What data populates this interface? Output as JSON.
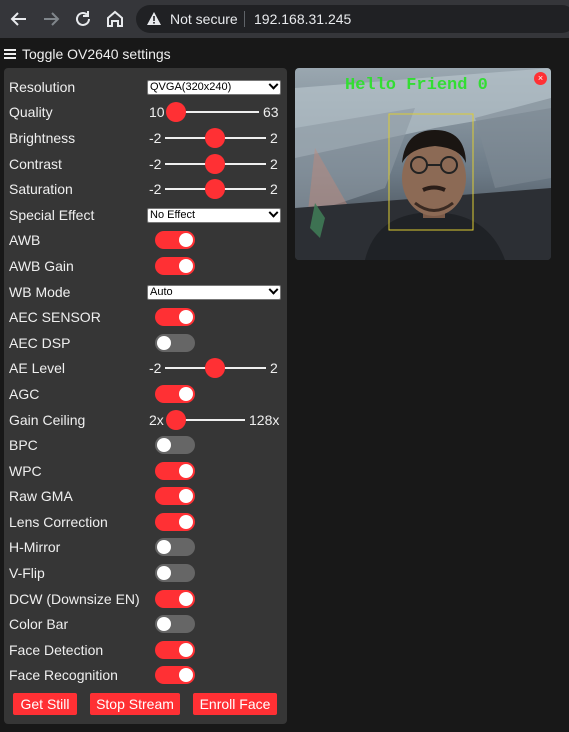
{
  "browser": {
    "security_label": "Not secure",
    "url": "192.168.31.245"
  },
  "page": {
    "toggle_label": "Toggle OV2640 settings"
  },
  "settings": {
    "resolution": {
      "label": "Resolution",
      "value": "QVGA(320x240)"
    },
    "quality": {
      "label": "Quality",
      "min": "10",
      "max": "63",
      "value": 10
    },
    "brightness": {
      "label": "Brightness",
      "min": "-2",
      "max": "2",
      "value": 0
    },
    "contrast": {
      "label": "Contrast",
      "min": "-2",
      "max": "2",
      "value": 0
    },
    "saturation": {
      "label": "Saturation",
      "min": "-2",
      "max": "2",
      "value": 0
    },
    "special_effect": {
      "label": "Special Effect",
      "value": "No Effect"
    },
    "awb": {
      "label": "AWB",
      "on": true
    },
    "awb_gain": {
      "label": "AWB Gain",
      "on": true
    },
    "wb_mode": {
      "label": "WB Mode",
      "value": "Auto"
    },
    "aec_sensor": {
      "label": "AEC SENSOR",
      "on": true
    },
    "aec_dsp": {
      "label": "AEC DSP",
      "on": false
    },
    "ae_level": {
      "label": "AE Level",
      "min": "-2",
      "max": "2",
      "value": 0
    },
    "agc": {
      "label": "AGC",
      "on": true
    },
    "gain_ceiling": {
      "label": "Gain Ceiling",
      "min": "2x",
      "max": "128x",
      "value": 0
    },
    "bpc": {
      "label": "BPC",
      "on": false
    },
    "wpc": {
      "label": "WPC",
      "on": true
    },
    "raw_gma": {
      "label": "Raw GMA",
      "on": true
    },
    "lens_correction": {
      "label": "Lens Correction",
      "on": true
    },
    "h_mirror": {
      "label": "H-Mirror",
      "on": false
    },
    "v_flip": {
      "label": "V-Flip",
      "on": false
    },
    "dcw": {
      "label": "DCW (Downsize EN)",
      "on": true
    },
    "color_bar": {
      "label": "Color Bar",
      "on": false
    },
    "face_detection": {
      "label": "Face Detection",
      "on": true
    },
    "face_recognition": {
      "label": "Face Recognition",
      "on": true
    }
  },
  "buttons": {
    "get_still": "Get Still",
    "stop_stream": "Stop Stream",
    "enroll_face": "Enroll Face"
  },
  "stream": {
    "overlay_text": "Hello Friend 0",
    "close_glyph": "×"
  },
  "colors": {
    "accent": "#ff3034",
    "panel": "#363636",
    "background": "#181818",
    "overlay_text": "#33dd33",
    "face_box": "#ddcc33"
  }
}
